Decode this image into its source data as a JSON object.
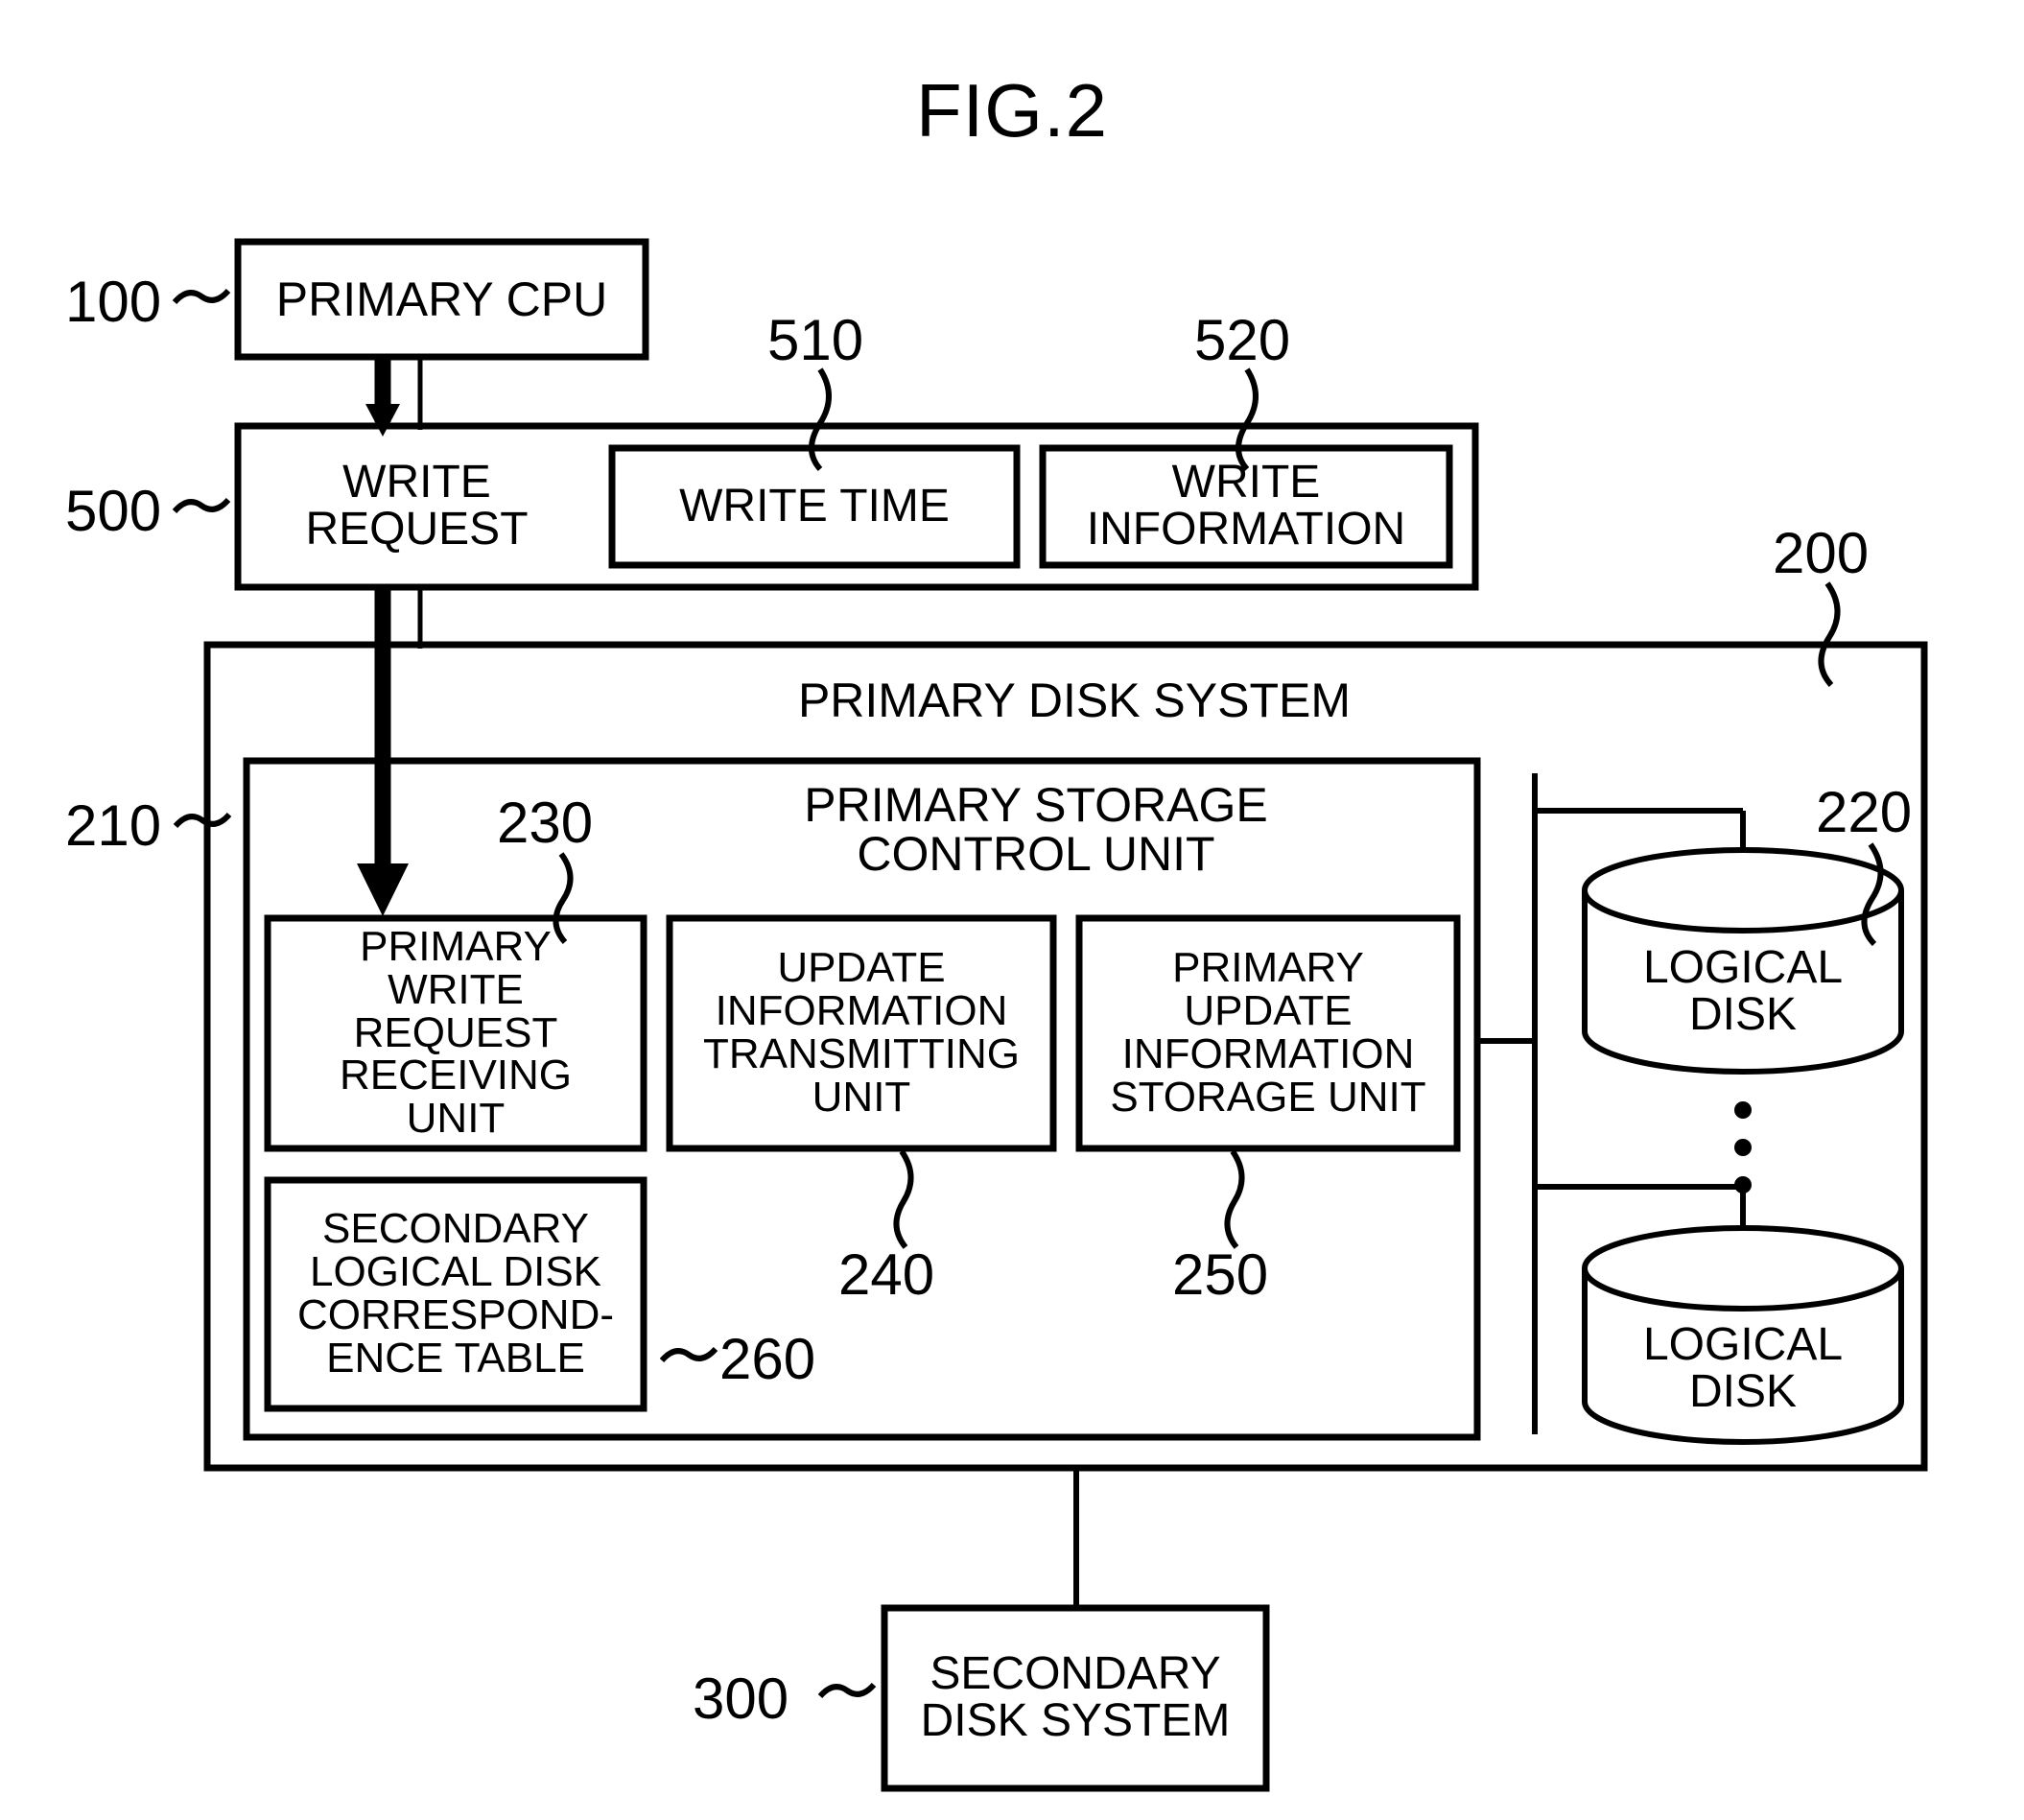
{
  "figure": {
    "title": "FIG.2",
    "type": "patent-block-diagram"
  },
  "reference_numerals": {
    "primary_cpu": "100",
    "write_request": "500",
    "write_time": "510",
    "write_information": "520",
    "primary_disk_system": "200",
    "primary_storage_control_unit": "210",
    "logical_disk_group": "220",
    "primary_write_request_receiving_unit": "230",
    "update_information_transmitting_unit": "240",
    "primary_update_information_storage_unit": "250",
    "secondary_logical_disk_correspondence_table": "260",
    "secondary_disk_system": "300"
  },
  "blocks": {
    "primary_cpu": {
      "label": "PRIMARY CPU"
    },
    "write_request": {
      "label": "WRITE\nREQUEST"
    },
    "write_time": {
      "label": "WRITE TIME"
    },
    "write_information": {
      "label": "WRITE\nINFORMATION"
    },
    "primary_disk_system": {
      "label": "PRIMARY DISK SYSTEM"
    },
    "primary_storage_control_unit": {
      "label": "PRIMARY STORAGE\nCONTROL UNIT"
    },
    "primary_write_request_receiving_unit": {
      "label": "PRIMARY\nWRITE\nREQUEST\nRECEIVING\nUNIT"
    },
    "update_information_transmitting_unit": {
      "label": "UPDATE\nINFORMATION\nTRANSMITTING\nUNIT"
    },
    "primary_update_information_storage_unit": {
      "label": "PRIMARY\nUPDATE\nINFORMATION\nSTORAGE UNIT"
    },
    "secondary_logical_disk_correspondence_table": {
      "label": "SECONDARY\nLOGICAL DISK\nCORRESPOND-\nENCE TABLE"
    },
    "logical_disk_top": {
      "label": "LOGICAL\nDISK"
    },
    "logical_disk_bottom": {
      "label": "LOGICAL\nDISK"
    },
    "secondary_disk_system": {
      "label": "SECONDARY\nDISK SYSTEM"
    }
  },
  "style": {
    "stroke": "#000000",
    "background": "#ffffff"
  }
}
